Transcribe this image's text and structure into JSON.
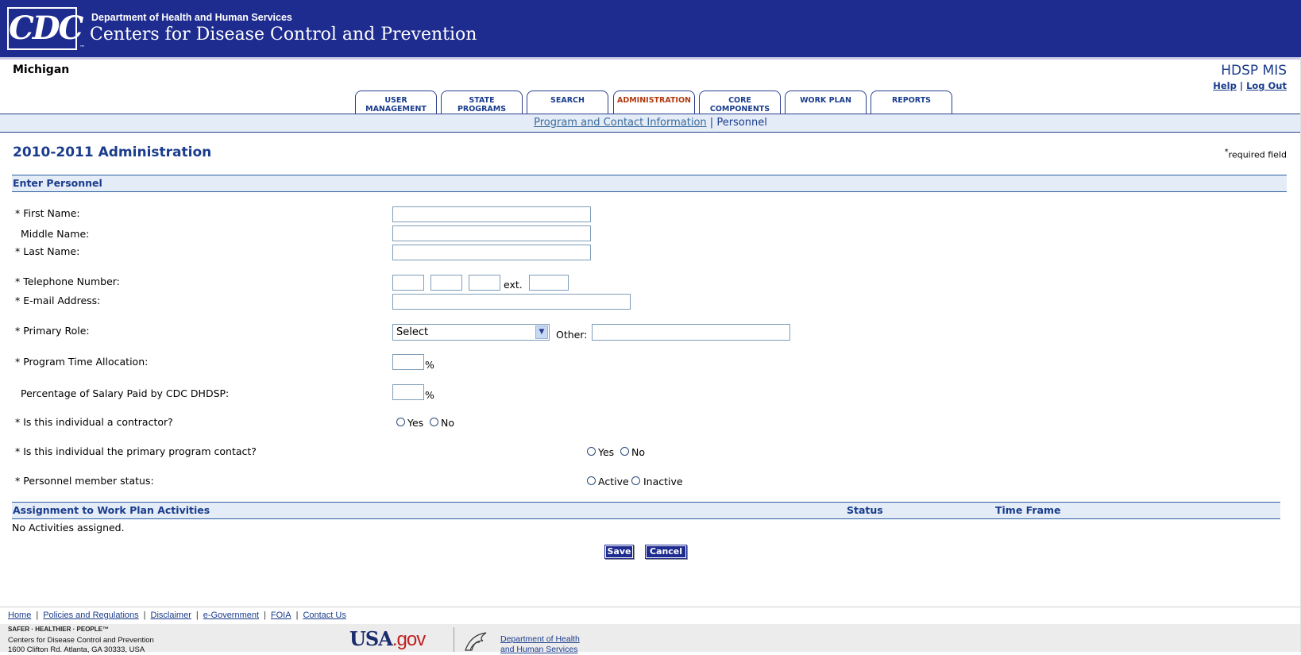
{
  "header": {
    "logo_text": "CDC",
    "logo_tm": "™",
    "department": "Department of Health and Human Services",
    "agency": "Centers for Disease Control and Prevention"
  },
  "top": {
    "state": "Michigan",
    "app_name": "HDSP MIS",
    "help": "Help",
    "logout": "Log Out",
    "link_sep": "|"
  },
  "tabs": [
    {
      "line1": "USER",
      "line2": "MANAGEMENT"
    },
    {
      "line1": "STATE",
      "line2": "PROGRAMS"
    },
    {
      "line1": "SEARCH",
      "line2": ""
    },
    {
      "line1": "ADMINISTRATION",
      "line2": "",
      "active": true
    },
    {
      "line1": "CORE",
      "line2": "COMPONENTS"
    },
    {
      "line1": "WORK PLAN",
      "line2": ""
    },
    {
      "line1": "REPORTS",
      "line2": ""
    }
  ],
  "subnav": {
    "link": "Program and Contact Information",
    "sep": "|",
    "current": "Personnel"
  },
  "page": {
    "title": "2010-2011 Administration",
    "required_star": "*",
    "required_text": "required field"
  },
  "form": {
    "section": "Enter Personnel",
    "first_name": "* First Name:",
    "middle_name": "Middle Name:",
    "last_name": "* Last Name:",
    "telephone": "* Telephone Number:",
    "ext": "ext.",
    "email": "* E-mail Address:",
    "primary_role": "* Primary Role:",
    "role_selected": "Select",
    "other": "Other:",
    "time_allocation": "* Program Time Allocation:",
    "salary_pct": "Percentage of Salary Paid by CDC DHDSP:",
    "percent": "%",
    "contractor_q": "* Is this individual a contractor?",
    "primary_contact_q": "* Is this individual the primary program contact?",
    "status_q": "* Personnel member status:",
    "yes": "Yes",
    "no": "No",
    "active": "Active",
    "inactive": "Inactive"
  },
  "assignments": {
    "header": "Assignment to Work Plan Activities",
    "status_col": "Status",
    "timeframe_col": "Time Frame",
    "empty": "No Activities assigned."
  },
  "buttons": {
    "save": "Save",
    "cancel": "Cancel"
  },
  "footer": {
    "links": [
      "Home",
      "Policies and Regulations",
      "Disclaimer",
      "e-Government",
      "FOIA",
      "Contact Us"
    ],
    "sep": "|",
    "tagline": "SAFER · HEALTHIER · PEOPLE™",
    "address1": "Centers for Disease Control and Prevention",
    "address2": "1600 Clifton Rd. Atlanta, GA 30333, USA",
    "usagov_a": "USA",
    "usagov_b": ".gov",
    "hhs_line1": "Department of Health",
    "hhs_line2": "and Human Services"
  }
}
